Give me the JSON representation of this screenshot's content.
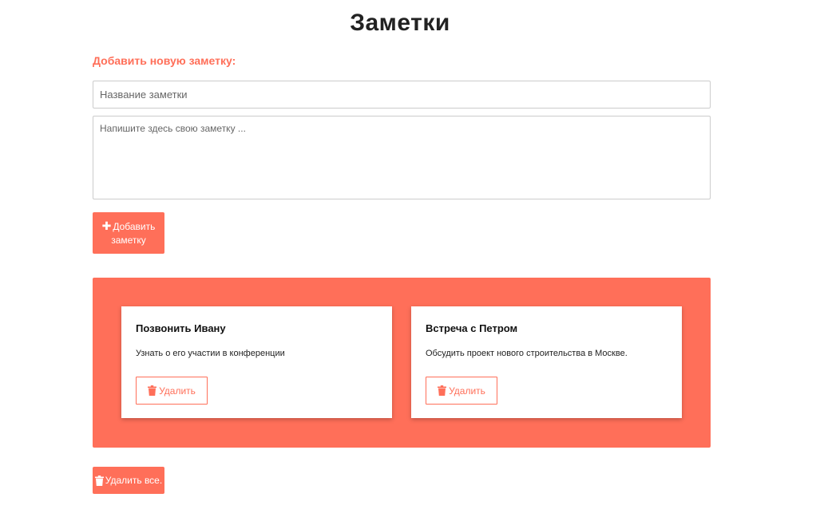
{
  "page": {
    "title": "Заметки"
  },
  "form": {
    "heading": "Добавить новую заметку:",
    "title_placeholder": "Название заметки",
    "title_value": "",
    "body_placeholder": "Напишите здесь свою заметку ...",
    "body_value": "",
    "add_button_label": "Добавить заметку",
    "add_button_icon": "plus-icon"
  },
  "notes": [
    {
      "title": "Позвонить Ивану",
      "body": "Узнать о его участии в конференции",
      "delete_label": "Удалить",
      "delete_icon": "trash-icon"
    },
    {
      "title": "Встреча с Петром",
      "body": "Обсудить проект нового строительства в Москве.",
      "delete_label": "Удалить",
      "delete_icon": "trash-icon"
    }
  ],
  "footer": {
    "delete_all_label": "Удалить все.",
    "delete_all_icon": "trash-icon"
  },
  "colors": {
    "accent": "#ff6f59",
    "background": "#ffffff",
    "text": "#222222",
    "input_border": "#cccccc"
  }
}
